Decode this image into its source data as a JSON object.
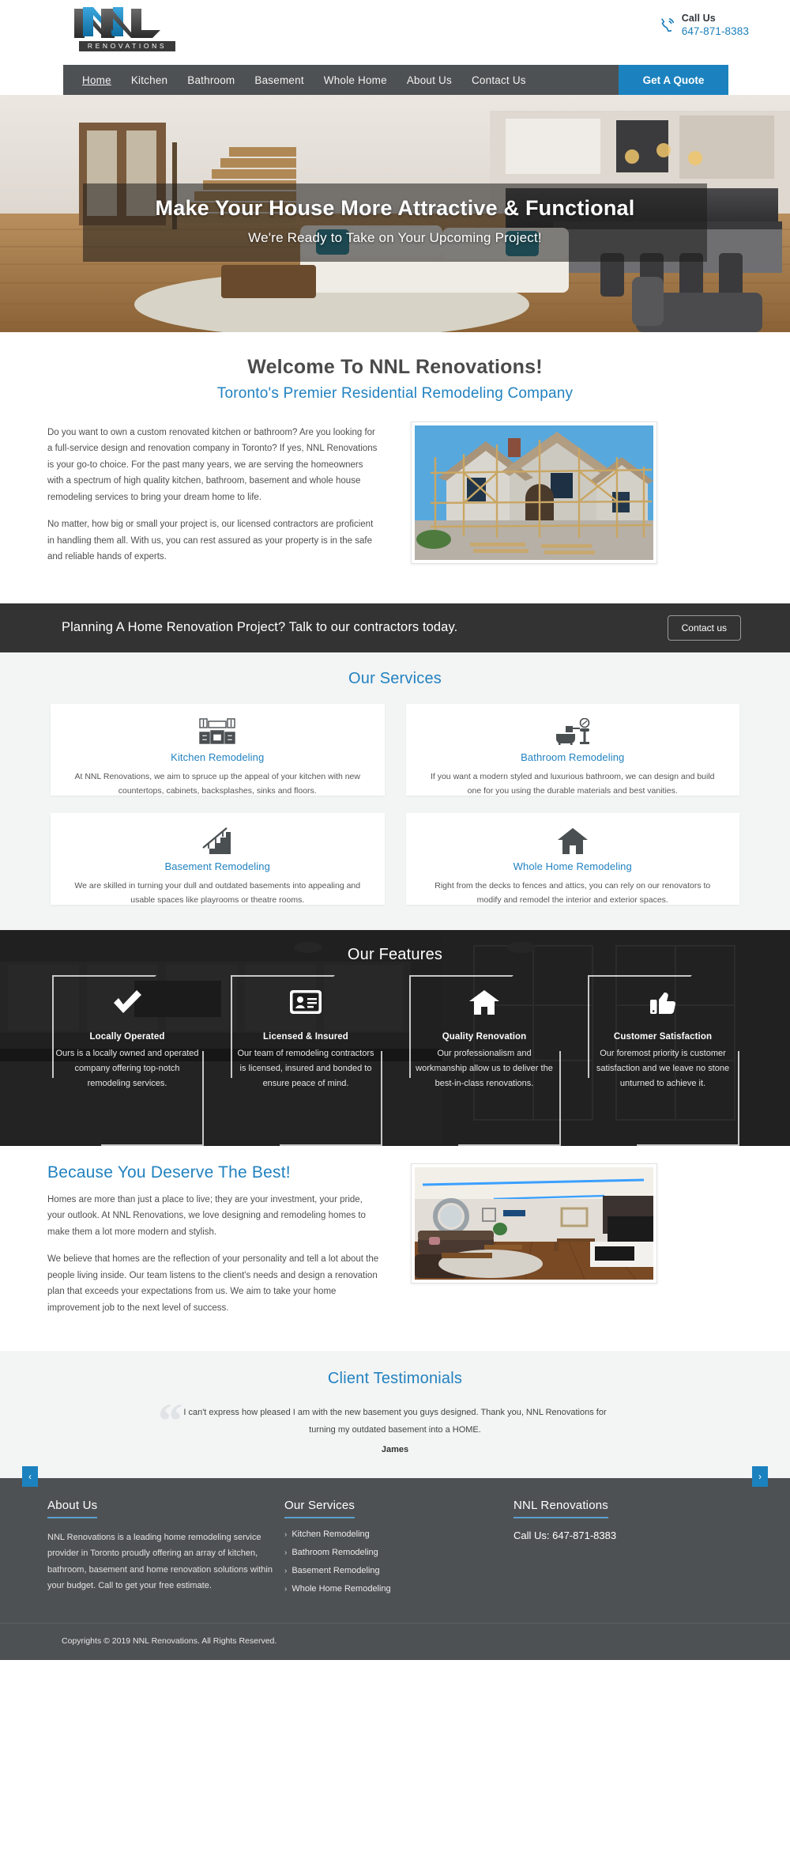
{
  "header": {
    "logo_text": "NNL",
    "logo_sub": "RENOVATIONS",
    "call_label": "Call Us",
    "phone": "647-871-8383",
    "phone_icon": "phone-ring-icon",
    "quote_button": "Get A Quote"
  },
  "nav": {
    "items": [
      {
        "label": "Home",
        "active": true
      },
      {
        "label": "Kitchen",
        "active": false
      },
      {
        "label": "Bathroom",
        "active": false
      },
      {
        "label": "Basement",
        "active": false
      },
      {
        "label": "Whole Home",
        "active": false
      },
      {
        "label": "About Us",
        "active": false
      },
      {
        "label": "Contact Us",
        "active": false
      }
    ]
  },
  "hero": {
    "title": "Make Your House More Attractive & Functional",
    "subtitle": "We're Ready to Take on Your Upcoming Project!"
  },
  "welcome": {
    "heading": "Welcome To NNL Renovations!",
    "subheading": "Toronto's Premier Residential Remodeling Company",
    "paragraph1": "Do you want to own a custom renovated kitchen or bathroom? Are you looking for a full-service design and renovation company in Toronto? If yes, NNL Renovations is your go-to choice. For the past many years, we are serving the homeowners with a spectrum of high quality kitchen, bathroom, basement and whole house remodeling services to bring your dream home to life.",
    "paragraph2": "No matter, how big or small your project is, our licensed contractors are proficient in handling them all. With us, you can rest assured as your property is in the safe and reliable hands of experts.",
    "image_alt": "house-under-construction-with-scaffolding"
  },
  "cta": {
    "text": "Planning A Home Renovation Project? Talk to our contractors today.",
    "button": "Contact us"
  },
  "services": {
    "title": "Our Services",
    "cards": [
      {
        "icon": "kitchen-cabinets-icon",
        "title": "Kitchen Remodeling",
        "desc": "At NNL Renovations, we aim to spruce up the appeal of your kitchen with new countertops, cabinets, backsplashes, sinks and floors."
      },
      {
        "icon": "bathtub-sink-mirror-icon",
        "title": "Bathroom Remodeling",
        "desc": "If you want a modern styled and luxurious bathroom, we can design and build one for you using the durable materials and best vanities."
      },
      {
        "icon": "staircase-icon",
        "title": "Basement Remodeling",
        "desc": "We are skilled in turning your dull and outdated basements into appealing and usable spaces like playrooms or theatre rooms."
      },
      {
        "icon": "house-icon",
        "title": "Whole Home Remodeling",
        "desc": "Right from the decks to fences and attics, you can rely on our renovators to modify and remodel the interior and exterior spaces."
      }
    ]
  },
  "features": {
    "title": "Our Features",
    "items": [
      {
        "icon": "checkmark-icon",
        "name": "Locally Operated",
        "desc": "Ours is a locally owned and operated company offering top-notch remodeling services."
      },
      {
        "icon": "id-card-icon",
        "name": "Licensed & Insured",
        "desc": "Our team of remodeling contractors is licensed, insured and bonded to ensure peace of mind."
      },
      {
        "icon": "house-icon",
        "name": "Quality Renovation",
        "desc": "Our professionalism and workmanship allow us to deliver the best-in-class renovations."
      },
      {
        "icon": "thumbs-up-icon",
        "name": "Customer Satisfaction",
        "desc": "Our foremost priority is customer satisfaction and we leave no stone unturned to achieve it."
      }
    ]
  },
  "deserve": {
    "heading": "Because You Deserve The Best!",
    "paragraph1": "Homes are more than just a place to live; they are your investment, your pride, your outlook. At NNL Renovations, we love designing and remodeling homes to make them a lot more modern and stylish.",
    "paragraph2": "We believe that homes are the reflection of your personality and tell a lot about the people living inside. Our team listens to the client's needs and design a renovation plan that exceeds your expectations from us. We aim to take your home improvement job to the next level of success.",
    "image_alt": "modern-living-room-with-led-ceiling-lighting"
  },
  "testimonials": {
    "title": "Client Testimonials",
    "quote_line1": "I can't express how pleased I am with the new basement you guys designed. Thank you, NNL Renovations for",
    "quote_line2": "turning my outdated basement into a HOME.",
    "author": "James",
    "prev": "‹",
    "next": "›"
  },
  "footer": {
    "about_title": "About Us",
    "about_text": "NNL Renovations is a leading home remodeling service provider in Toronto proudly offering an array of kitchen, bathroom, basement and home renovation solutions within your budget. Call to get your free estimate.",
    "services_title": "Our Services",
    "services_links": [
      "Kitchen Remodeling",
      "Bathroom Remodeling",
      "Basement Remodeling",
      "Whole Home Remodeling"
    ],
    "contact_title": "NNL Renovations",
    "contact_phone": "Call Us: 647-871-8383",
    "copyright": "Copyrights © 2019 NNL Renovations. All Rights Reserved."
  },
  "colors": {
    "accent_blue": "#1b82bf",
    "link_blue": "#2282c0",
    "nav_gray": "#4e5153",
    "cta_dark": "#333333",
    "light_bg": "#f3f4f4"
  }
}
